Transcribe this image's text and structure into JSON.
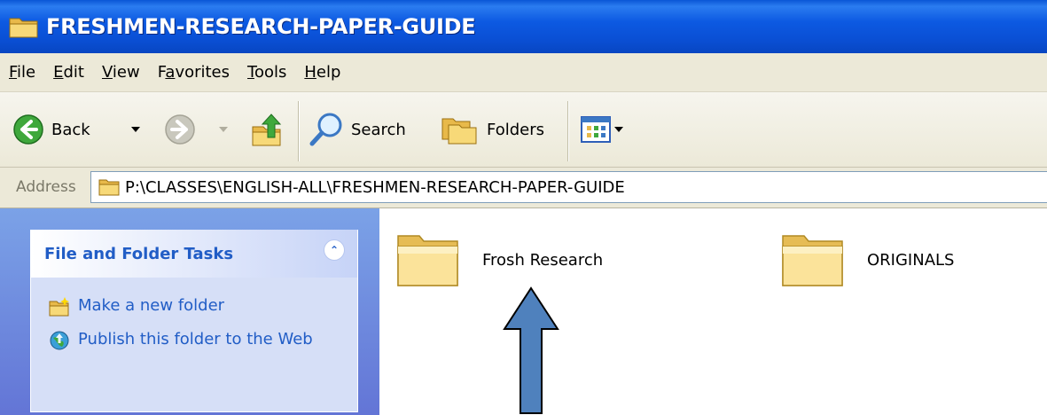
{
  "window": {
    "title": "FRESHMEN-RESEARCH-PAPER-GUIDE"
  },
  "menu": [
    {
      "label": "File",
      "accel": "F",
      "rest": "ile"
    },
    {
      "label": "Edit",
      "accel": "E",
      "rest": "dit"
    },
    {
      "label": "View",
      "accel": "V",
      "rest": "iew"
    },
    {
      "label": "Favorites",
      "pre": "F",
      "accel": "a",
      "rest": "vorites"
    },
    {
      "label": "Tools",
      "accel": "T",
      "rest": "ools"
    },
    {
      "label": "Help",
      "accel": "H",
      "rest": "elp"
    }
  ],
  "toolbar": {
    "back_label": "Back",
    "search_label": "Search",
    "folders_label": "Folders"
  },
  "address": {
    "label": "Address",
    "value": "P:\\CLASSES\\ENGLISH-ALL\\FRESHMEN-RESEARCH-PAPER-GUIDE"
  },
  "taskpane": {
    "title": "File and Folder Tasks",
    "links": [
      {
        "label": "Make a new folder",
        "icon": "new-folder-icon"
      },
      {
        "label": "Publish this folder to the Web",
        "icon": "publish-web-icon"
      }
    ]
  },
  "folders": [
    {
      "name": "Frosh Research"
    },
    {
      "name": "ORIGINALS"
    }
  ],
  "colors": {
    "titlebar": "#0a4fd4",
    "chrome": "#ece9d8",
    "taskpane": "#6f8fdf",
    "link": "#215dc6",
    "annotation_arrow": "#4f81bd"
  }
}
